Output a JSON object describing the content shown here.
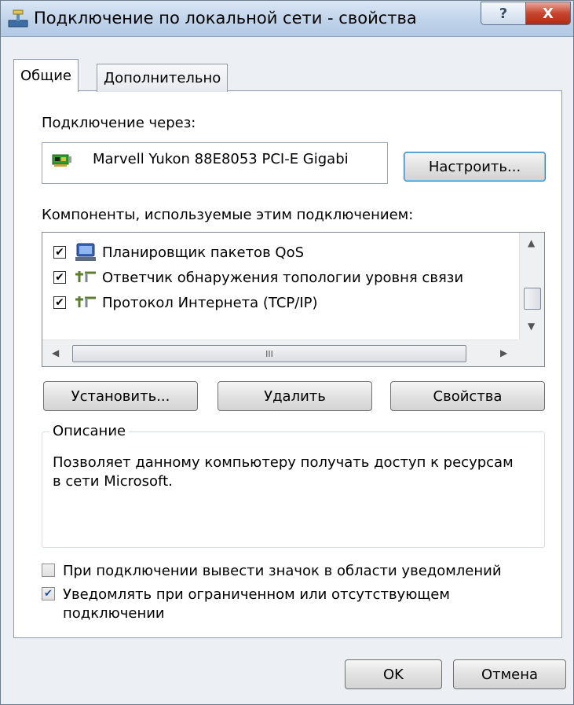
{
  "window": {
    "title": "Подключение по локальной сети - свойства",
    "help_label": "?",
    "close_label": "X"
  },
  "tabs": [
    {
      "label": "Общие",
      "active": true
    },
    {
      "label": "Дополнительно",
      "active": false
    }
  ],
  "connect_via": {
    "label": "Подключение через:",
    "adapter_name": "Marvell Yukon 88E8053 PCI-E Gigabi",
    "adapter_icon": "network-card-icon",
    "configure_button": "Настроить..."
  },
  "components": {
    "label": "Компоненты, используемые этим подключением:",
    "items": [
      {
        "label": "Планировщик пакетов QoS",
        "checked": true,
        "icon": "qos-scheduler-icon"
      },
      {
        "label": "Ответчик обнаружения топологии уровня связи",
        "checked": true,
        "icon": "network-protocol-icon"
      },
      {
        "label": "Протокол Интернета (TCP/IP)",
        "checked": true,
        "icon": "network-protocol-icon"
      }
    ],
    "scroll_grip": "III"
  },
  "actions": {
    "install": "Установить...",
    "remove": "Удалить",
    "properties": "Свойства"
  },
  "description": {
    "group_label": "Описание",
    "text": "Позволяет данному компьютеру получать доступ к ресурсам в сети Microsoft."
  },
  "options": [
    {
      "label": "При подключении вывести значок в области уведомлений",
      "checked": false
    },
    {
      "label": "Уведомлять при ограниченном или отсутствующем подключении",
      "checked": true
    }
  ],
  "footer": {
    "ok": "OK",
    "cancel": "Отмена"
  },
  "colors": {
    "accent": "#3c7fb1",
    "close": "#c8452f",
    "check": "#1c4f9c"
  }
}
